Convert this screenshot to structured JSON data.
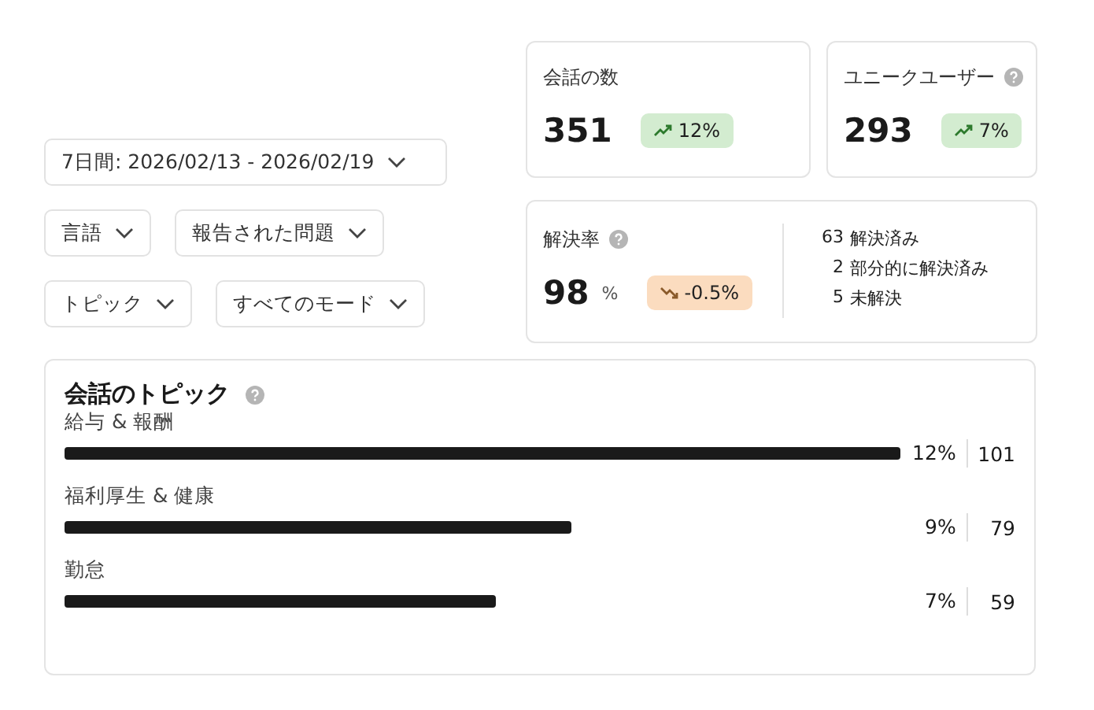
{
  "filter_rows": [
    [
      {
        "label": "7日間: 2026/02/13 - 2026/02/19"
      }
    ],
    [
      {
        "label": "言語"
      },
      {
        "label": "報告された問題"
      }
    ],
    [
      {
        "label": "トピック"
      },
      {
        "label": "すべてのモード"
      }
    ]
  ],
  "stats": [
    {
      "title": "会話の数",
      "help": false,
      "value": "351",
      "change": "12%",
      "kind": "up"
    },
    {
      "title": "ユニークユーザー",
      "help": true,
      "value": "293",
      "change": "7%",
      "kind": "up"
    }
  ],
  "resolution": {
    "title": "解決率",
    "help": true,
    "value": "98",
    "unit": "%",
    "change": "-0.5%",
    "kind": "down",
    "breakdown": [
      {
        "count": "63",
        "label": "解決済み"
      },
      {
        "count": "2",
        "label": "部分的に解決済み"
      },
      {
        "count": "5",
        "label": "未解決"
      }
    ]
  },
  "topics": {
    "title": "会話のトピック",
    "help": true,
    "rows": [
      {
        "name": "給与 & 報酬",
        "percent": "12%",
        "count": "101"
      },
      {
        "name": "福利厚生 & 健康",
        "percent": "9%",
        "count": "79"
      },
      {
        "name": "勤怠",
        "percent": "7%",
        "count": "59"
      }
    ]
  }
}
